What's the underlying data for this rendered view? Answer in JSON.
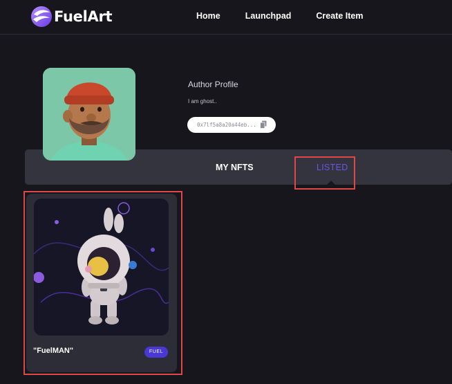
{
  "brand": {
    "name": "FuelArt"
  },
  "nav": {
    "items": [
      {
        "label": "Home"
      },
      {
        "label": "Launchpad"
      },
      {
        "label": "Create Item"
      }
    ]
  },
  "profile": {
    "title": "Author Profile",
    "bio": "I am ghost..",
    "address": "0x7lf5a8a20a44eb...",
    "avatar_icon": "person-3d-avatar"
  },
  "tabs": {
    "items": [
      {
        "label": "MY NFTS"
      },
      {
        "label": "LISTED"
      }
    ],
    "active": "LISTED"
  },
  "nft_card": {
    "title": "\"FuelMAN\"",
    "badge": "FUEL"
  },
  "colors": {
    "background": "#16161c",
    "tab_bar": "#34343f",
    "accent": "#6b54e8",
    "badge": "#4b37d6",
    "highlight": "#e04848"
  }
}
